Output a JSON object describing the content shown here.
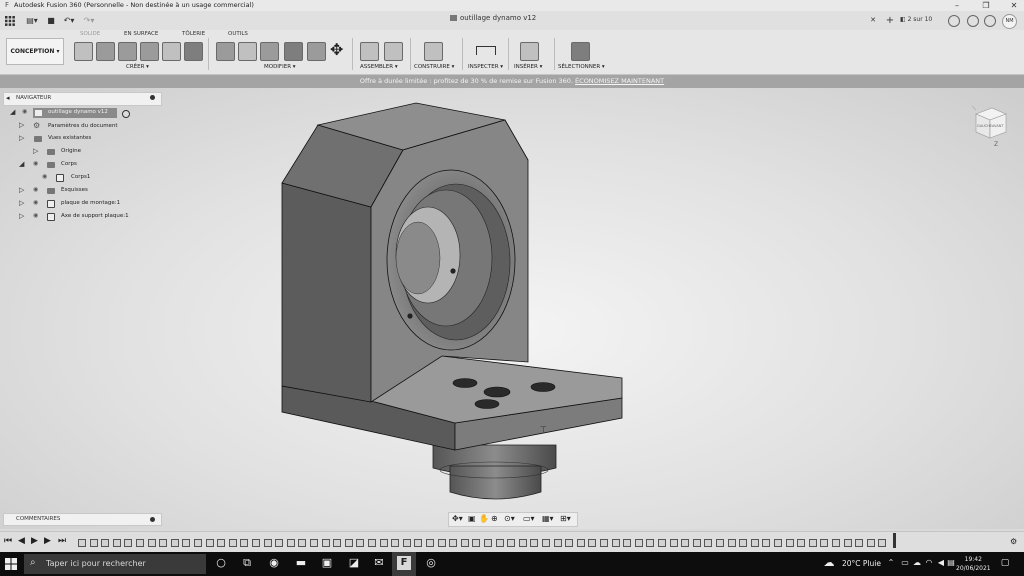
{
  "window": {
    "title": "Autodesk Fusion 360 (Personnelle - Non destinée à un usage commercial)",
    "fusion_icon": "F",
    "minimize": "–",
    "maximize": "❐",
    "close": "✕"
  },
  "appbar": {
    "document_tab": "outillage dynamo v12",
    "tab_close": "✕",
    "new_tab": "+",
    "tab_count": "2 sur 10",
    "avatar_initials": "NM"
  },
  "toolbar": {
    "workspace": "CONCEPTION ▾",
    "tabs": [
      "SOLIDE",
      "EN SURFACE",
      "TÔLERIE",
      "OUTILS"
    ],
    "groups": {
      "creer": "CRÉER ▾",
      "modifier": "MODIFIER ▾",
      "assembler": "ASSEMBLER ▾",
      "construire": "CONSTRUIRE ▾",
      "inspecter": "INSPECTER ▾",
      "inserer": "INSÉRER ▾",
      "selectionner": "SÉLECTIONNER ▾"
    }
  },
  "promo": {
    "text": "Offre à durée limitée : profitez de 30 % de remise sur Fusion 360. ",
    "link": "ÉCONOMISEZ MAINTENANT"
  },
  "navigator": {
    "header": "NAVIGATEUR",
    "root": "outillage dynamo v12",
    "items": [
      {
        "label": "Paramètres du document"
      },
      {
        "label": "Vues existantes"
      },
      {
        "label": "Origine"
      },
      {
        "label": "Corps"
      },
      {
        "label": "Corps1"
      },
      {
        "label": "Esquisses"
      },
      {
        "label": "plaque de montage:1"
      },
      {
        "label": "Axe de support plaque:1"
      }
    ]
  },
  "viewcube": {
    "left_face": "GAUCHE",
    "right_face": "AVANT",
    "axis_label": "Z"
  },
  "comments": {
    "header": "COMMENTAIRES"
  },
  "taskbar": {
    "search_placeholder": "Taper ici pour rechercher",
    "weather": "20°C  Pluie",
    "time": "19:42",
    "date": "20/06/2021"
  },
  "colors": {
    "accent": "#8a8a8a"
  }
}
